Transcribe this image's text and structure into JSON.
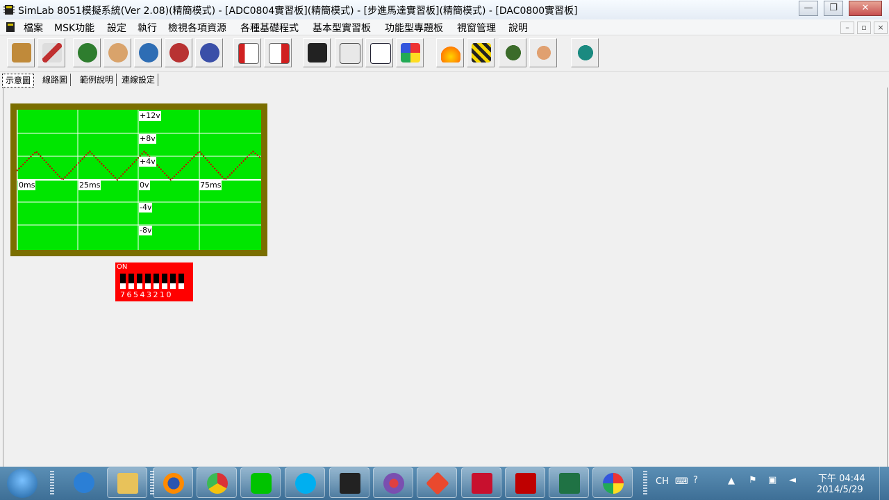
{
  "window": {
    "title": "SimLab 8051模擬系統(Ver  2.08)(精簡模式) - [ADC0804實習板](精簡模式) - [步進馬達實習板](精簡模式) - [DAC0800實習板]",
    "minimize": "—",
    "restore": "❐",
    "close": "✕"
  },
  "menu": {
    "items": [
      "檔案",
      "MSK功能",
      "設定",
      "執行",
      "檢視各項資源",
      "各種基礎程式",
      "基本型實習板",
      "功能型專題板",
      "視窗管理",
      "說明"
    ],
    "mdi_minimize": "–",
    "mdi_restore": "▫",
    "mdi_close": "×"
  },
  "toolbar": {
    "icons": [
      "book-icon",
      "tools-icon",
      "person-1-icon",
      "person-2-icon",
      "person-3-icon",
      "person-4-icon",
      "person-5-icon",
      "load-icon",
      "export-icon",
      "chip-icon",
      "document-icon",
      "binary-icon",
      "palette-board-icon",
      "flame-icon",
      "clapper-icon",
      "grenade-icon",
      "thumb-icon",
      "help-icon"
    ]
  },
  "tabs": [
    "示意圖",
    "線路圖",
    "範例說明",
    "連線設定"
  ],
  "oscilloscope": {
    "y_labels": [
      "+12v",
      "+8v",
      "+4v",
      "0v",
      "-4v",
      "-8v"
    ],
    "x_labels": [
      "0ms",
      "25ms",
      "75ms"
    ],
    "colors": {
      "frame": "#7a6e00",
      "screen": "#00e600",
      "grid": "#ffffff",
      "trace": "#cc0000"
    }
  },
  "dip_switch": {
    "on_label": "ON",
    "numbers": "76543210"
  },
  "taskbar": {
    "apps": [
      "ie-icon",
      "explorer-icon",
      "firefox-icon",
      "chrome-icon",
      "line-icon",
      "skype-icon",
      "simlab-icon",
      "magnifier-icon",
      "git-icon",
      "acrobat-icon",
      "filezilla-icon",
      "excel-icon",
      "paint-icon"
    ],
    "lang": "CH",
    "time": "下午 04:44",
    "date": "2014/5/29"
  }
}
